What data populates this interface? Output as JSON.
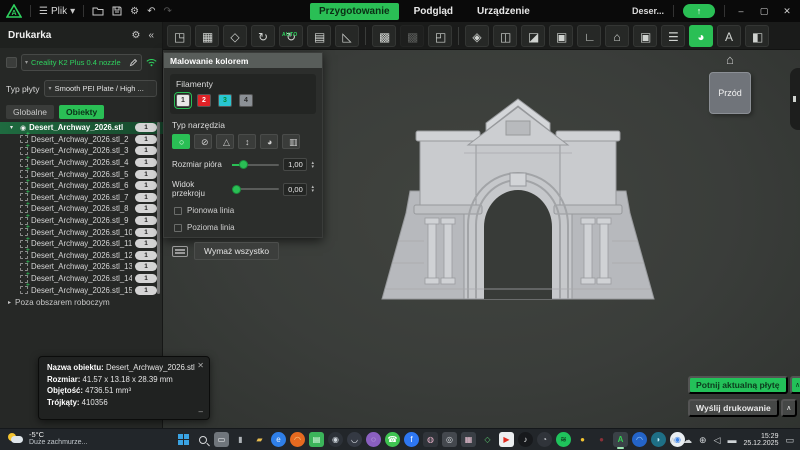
{
  "titlebar": {
    "menu_file": "Plik",
    "project": "Deser...",
    "upload_glyph": "↑",
    "window_controls": {
      "minimize": "–",
      "maximize": "▢",
      "close": "✕"
    }
  },
  "tabs": [
    {
      "label": "Przygotowanie",
      "active": true
    },
    {
      "label": "Podgląd",
      "active": false
    },
    {
      "label": "Urządzenie",
      "active": false
    }
  ],
  "toolbar": {
    "icons": [
      {
        "name": "add-model",
        "glyph": "◳"
      },
      {
        "name": "arrange-plate",
        "glyph": "▦"
      },
      {
        "name": "arrange-all",
        "glyph": "◇"
      },
      {
        "name": "rotate",
        "glyph": "↻"
      },
      {
        "name": "auto-orient",
        "glyph": "↻",
        "badge": "AUTO"
      },
      {
        "name": "merge-plate",
        "glyph": "▤"
      },
      {
        "name": "lay-flat",
        "glyph": "◺"
      },
      {
        "name": "separator-1",
        "type": "sep"
      },
      {
        "name": "clone",
        "glyph": "▩"
      },
      {
        "name": "clone-grid",
        "glyph": "▩",
        "disabled": true
      },
      {
        "name": "transform",
        "glyph": "◰"
      },
      {
        "name": "separator-2",
        "type": "sep"
      },
      {
        "name": "iso-box",
        "glyph": "◈"
      },
      {
        "name": "box-in-box",
        "glyph": "◫"
      },
      {
        "name": "slash-box",
        "glyph": "◪"
      },
      {
        "name": "overlap",
        "glyph": "▣"
      },
      {
        "name": "lay-corner",
        "glyph": "∟"
      },
      {
        "name": "support-tower",
        "glyph": "⌂"
      },
      {
        "name": "shield-box",
        "glyph": "▣"
      },
      {
        "name": "layers",
        "glyph": "☰"
      },
      {
        "name": "paint",
        "glyph": "◕",
        "active": true
      },
      {
        "name": "text-tool",
        "glyph": "A"
      },
      {
        "name": "split",
        "glyph": "◧"
      }
    ]
  },
  "sidebar": {
    "title": "Drukarka",
    "gear_glyph": "⚙",
    "collapse_glyph": "«",
    "printer_name": "Creality K2 Plus 0.4 nozzle",
    "plate_label": "Typ płyty",
    "plate_value": "Smooth PEI Plate / High ...",
    "tabs": [
      {
        "label": "Globalne",
        "active": false
      },
      {
        "label": "Obiekty",
        "active": true
      }
    ],
    "objects": [
      {
        "name": "Desert_Archway_2026.stl",
        "count": "1",
        "selected": true
      },
      {
        "name": "Desert_Archway_2026.stl_2",
        "count": "1"
      },
      {
        "name": "Desert_Archway_2026.stl_3",
        "count": "1"
      },
      {
        "name": "Desert_Archway_2026.stl_4",
        "count": "1"
      },
      {
        "name": "Desert_Archway_2026.stl_5",
        "count": "1"
      },
      {
        "name": "Desert_Archway_2026.stl_6",
        "count": "1"
      },
      {
        "name": "Desert_Archway_2026.stl_7",
        "count": "1"
      },
      {
        "name": "Desert_Archway_2026.stl_8",
        "count": "1"
      },
      {
        "name": "Desert_Archway_2026.stl_9",
        "count": "1"
      },
      {
        "name": "Desert_Archway_2026.stl_10",
        "count": "1"
      },
      {
        "name": "Desert_Archway_2026.stl_11",
        "count": "1"
      },
      {
        "name": "Desert_Archway_2026.stl_12",
        "count": "1"
      },
      {
        "name": "Desert_Archway_2026.stl_13",
        "count": "1"
      },
      {
        "name": "Desert_Archway_2026.stl_14",
        "count": "1"
      },
      {
        "name": "Desert_Archway_2026.stl_15",
        "count": "1"
      }
    ],
    "outside_group": "Poza obszarem roboczym"
  },
  "paint_panel": {
    "title": "Malowanie kolorem",
    "filaments_label": "Filamenty",
    "filaments": [
      {
        "id": "1",
        "color": "#e8e8e8",
        "text": "#333",
        "selected": true
      },
      {
        "id": "2",
        "color": "#e02227",
        "text": "#fff"
      },
      {
        "id": "3",
        "color": "#29c6d2",
        "text": "#083"
      },
      {
        "id": "4",
        "color": "#8b9095",
        "text": "#2a2a2a"
      }
    ],
    "tool_label": "Typ narzędzia",
    "tools": [
      {
        "name": "tool-circle",
        "glyph": "○",
        "active": true
      },
      {
        "name": "tool-sphere",
        "glyph": "⊘"
      },
      {
        "name": "tool-triangle",
        "glyph": "△"
      },
      {
        "name": "tool-height-range",
        "glyph": "↕"
      },
      {
        "name": "tool-fill",
        "glyph": "◕"
      },
      {
        "name": "tool-gap-fill",
        "glyph": "▥"
      }
    ],
    "pen_size_label": "Rozmiar pióra",
    "pen_size_value": "1,00",
    "section_label": "Widok przekroju",
    "section_value": "0,00",
    "checkbox_vertical": "Pionowa linia",
    "checkbox_horizontal": "Pozioma linia",
    "erase_label": "Wymaż wszystko"
  },
  "viewport": {
    "home_glyph": "⌂",
    "view_cube_label": "Przód"
  },
  "info_panel": {
    "name_label": "Nazwa obiektu:",
    "name_value": "Desert_Archway_2026.stl",
    "size_label": "Rozmiar:",
    "size_value": "41.57 x 13.18 x 28.39 mm",
    "volume_label": "Objętość:",
    "volume_value": "4736.51 mm³",
    "triangles_label": "Trójkąty:",
    "triangles_value": "410356",
    "close_glyph": "✕",
    "minimize_glyph": "–"
  },
  "actions": {
    "slice_label": "Potnij aktualną płytę",
    "send_label": "Wyślij drukowanie",
    "arrow_glyph": "∧"
  },
  "taskbar": {
    "weather": {
      "temp": "-5°C",
      "desc": "Duże zachmurze..."
    },
    "icons": [
      {
        "name": "start",
        "type": "win"
      },
      {
        "name": "search",
        "type": "lens"
      },
      {
        "name": "chat",
        "bg": "#70767c",
        "fg": "#f2f4f6",
        "glyph": "▭"
      },
      {
        "name": "mic",
        "bg": "transparent",
        "fg": "#aeb3b7",
        "glyph": "▮"
      },
      {
        "name": "explorer",
        "bg": "transparent",
        "fg": "#e9bd4f",
        "glyph": "▰"
      },
      {
        "name": "edge",
        "bg": "#2f7fe8",
        "fg": "#eaf4ff",
        "glyph": "e",
        "round": true
      },
      {
        "name": "firefox",
        "bg": "#e66a20",
        "fg": "#ffd089",
        "glyph": "◠",
        "round": true
      },
      {
        "name": "notes",
        "bg": "#3bb45a",
        "fg": "#eafff0",
        "glyph": "▤"
      },
      {
        "name": "steam",
        "bg": "#2c3138",
        "fg": "#cfd6dd",
        "glyph": "◉",
        "round": true
      },
      {
        "name": "discord",
        "bg": "#343943",
        "fg": "#dfe3ea",
        "glyph": "◡",
        "round": true
      },
      {
        "name": "viber",
        "bg": "#8a5fc0",
        "fg": "#ffffff",
        "glyph": "◌",
        "round": true
      },
      {
        "name": "whatsapp",
        "bg": "#3fc351",
        "fg": "#ffffff",
        "glyph": "☎",
        "round": true
      },
      {
        "name": "facebook",
        "bg": "#2e77f2",
        "fg": "#ffffff",
        "glyph": "f",
        "round": true
      },
      {
        "name": "photos-app",
        "bg": "#30343a",
        "fg": "#e8b1c8",
        "glyph": "◍"
      },
      {
        "name": "camera",
        "bg": "#44484e",
        "fg": "#d6dade",
        "glyph": "◎"
      },
      {
        "name": "gallery",
        "bg": "#3a3f45",
        "fg": "#f0c7d8",
        "glyph": "▦"
      },
      {
        "name": "gphotos",
        "bg": "transparent",
        "fg": "#58c06b",
        "glyph": "◇"
      },
      {
        "name": "youtube",
        "bg": "#eceff1",
        "fg": "#e02b20",
        "glyph": "▶"
      },
      {
        "name": "tiktok",
        "bg": "#17191c",
        "fg": "#f2f4f6",
        "glyph": "♪",
        "round": true
      },
      {
        "name": "obs",
        "bg": "#30343a",
        "fg": "#cfd3d7",
        "glyph": "◔",
        "round": true
      },
      {
        "name": "spotify",
        "bg": "#1fc35c",
        "fg": "#0d2b17",
        "glyph": "≋",
        "round": true
      },
      {
        "name": "tweety",
        "bg": "transparent",
        "fg": "#f4c430",
        "glyph": "●"
      },
      {
        "name": "dark-sphere",
        "bg": "transparent",
        "fg": "#8a3038",
        "glyph": "●"
      },
      {
        "name": "creality",
        "bg": "#3a4147",
        "fg": "#35cf55",
        "glyph": "A",
        "active": true
      },
      {
        "name": "edge-beta",
        "bg": "#2464c8",
        "fg": "#9fd4ff",
        "glyph": "◠",
        "round": true
      },
      {
        "name": "bing",
        "bg": "#1e6f86",
        "fg": "#bfeaf6",
        "glyph": "◗",
        "round": true
      },
      {
        "name": "chrome",
        "bg": "#e9eef2",
        "fg": "#3a82e8",
        "glyph": "◉",
        "round": true
      }
    ],
    "tray": [
      {
        "name": "tray-expand",
        "glyph": "∧"
      },
      {
        "name": "onedrive",
        "glyph": "☁"
      },
      {
        "name": "network",
        "glyph": "⊕"
      },
      {
        "name": "volume",
        "glyph": "◁"
      },
      {
        "name": "language",
        "glyph": "▬"
      }
    ],
    "clock": {
      "time": "15:29",
      "date": "25.12.2025"
    },
    "notification_glyph": "▭"
  },
  "colors": {
    "accent_green": "#2abf55",
    "selected_row_green": "#1b5c38",
    "viewport_gray": "#3a3d3a",
    "filament_red": "#e02227",
    "filament_cyan": "#29c6d2"
  }
}
